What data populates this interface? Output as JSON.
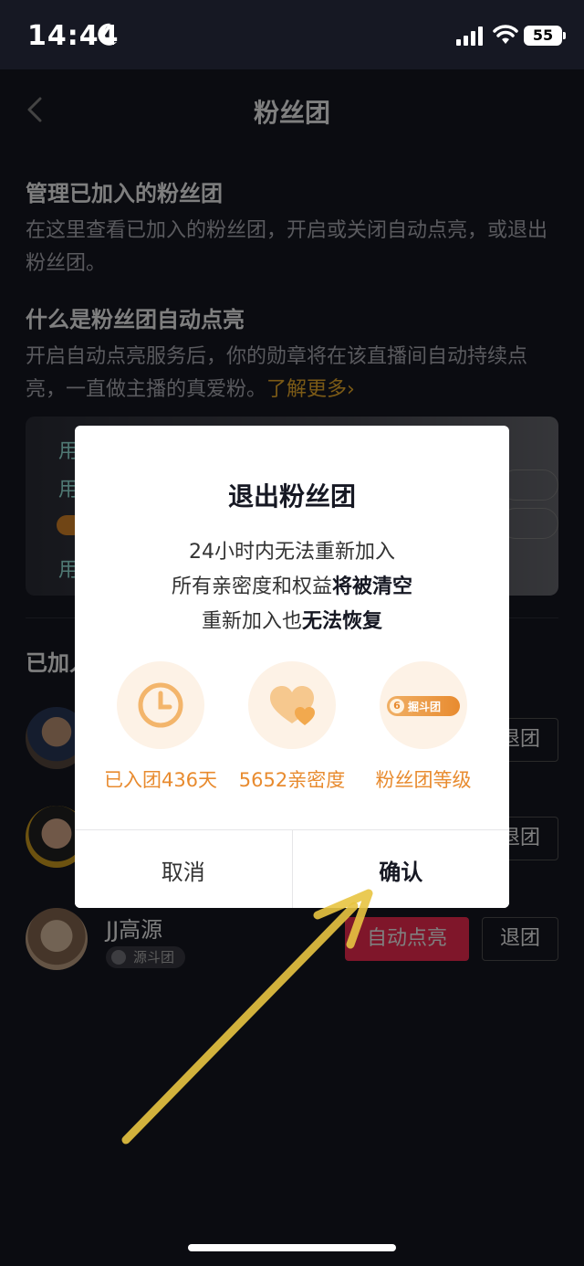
{
  "status_bar": {
    "time": "14:44",
    "battery": "55"
  },
  "page": {
    "title": "粉丝团",
    "section1": {
      "title": "管理已加入的粉丝团",
      "desc": "在这里查看已加入的粉丝团，开启或关闭自动点亮，或退出粉丝团。"
    },
    "section2": {
      "title": "什么是粉丝团自动点亮",
      "desc": "开启自动点亮服务后，你的勋章将在该直播间自动持续点亮，一直做主播的真爱粉。",
      "learn_more": "了解更多›"
    },
    "banner": {
      "row_char": "用"
    },
    "joined_label": "已加入",
    "list": [
      {
        "name": "",
        "badge": "",
        "quit": "退团"
      },
      {
        "name": "",
        "badge": "",
        "quit": "退团"
      },
      {
        "name": "JJ高源",
        "badge": "源斗团",
        "auto_light": "自动点亮",
        "quit": "退团"
      }
    ]
  },
  "dialog": {
    "title": "退出粉丝团",
    "line1": "24小时内无法重新加入",
    "line2_prefix": "所有亲密度和权益",
    "line2_bold": "将被清空",
    "line3_prefix": "重新加入也",
    "line3_bold": "无法恢复",
    "features": [
      {
        "icon": "clock-icon",
        "label": "已入团436天"
      },
      {
        "icon": "heart-icon",
        "label": "5652亲密度"
      },
      {
        "icon": "fan-level-badge",
        "badge_level": "6",
        "badge_name": "掘斗团",
        "label": "粉丝团等级"
      }
    ],
    "cancel": "取消",
    "confirm": "确认"
  },
  "colors": {
    "background": "#161823",
    "accent_orange": "#e88b2f",
    "auto_light_red": "#fe2c55",
    "learn_more_yellow": "#f7b52c",
    "annotation_arrow": "#e8c441"
  }
}
